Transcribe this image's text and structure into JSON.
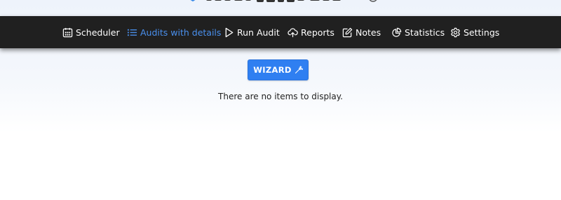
{
  "nav": {
    "items": [
      {
        "label": "Scheduler",
        "icon": "calendar-icon",
        "active": false
      },
      {
        "label": "Audits with details",
        "icon": "list-icon",
        "active": true
      },
      {
        "label": "Run Audit",
        "icon": "play-icon",
        "active": false
      },
      {
        "label": "Reports",
        "icon": "cloud-upload-icon",
        "active": false
      },
      {
        "label": "Notes",
        "icon": "edit-icon",
        "active": false
      },
      {
        "label": "Statistics",
        "icon": "pie-chart-icon",
        "active": false
      },
      {
        "label": "Settings",
        "icon": "gear-icon",
        "active": false
      }
    ]
  },
  "main": {
    "wizard_label": "WIZARD",
    "wizard_icon": "magic-wand-icon",
    "empty_message": "There are no items to display."
  },
  "colors": {
    "navbar_bg": "#202020",
    "active_nav": "#4a90ee",
    "button_bg": "#2f7ff1"
  }
}
